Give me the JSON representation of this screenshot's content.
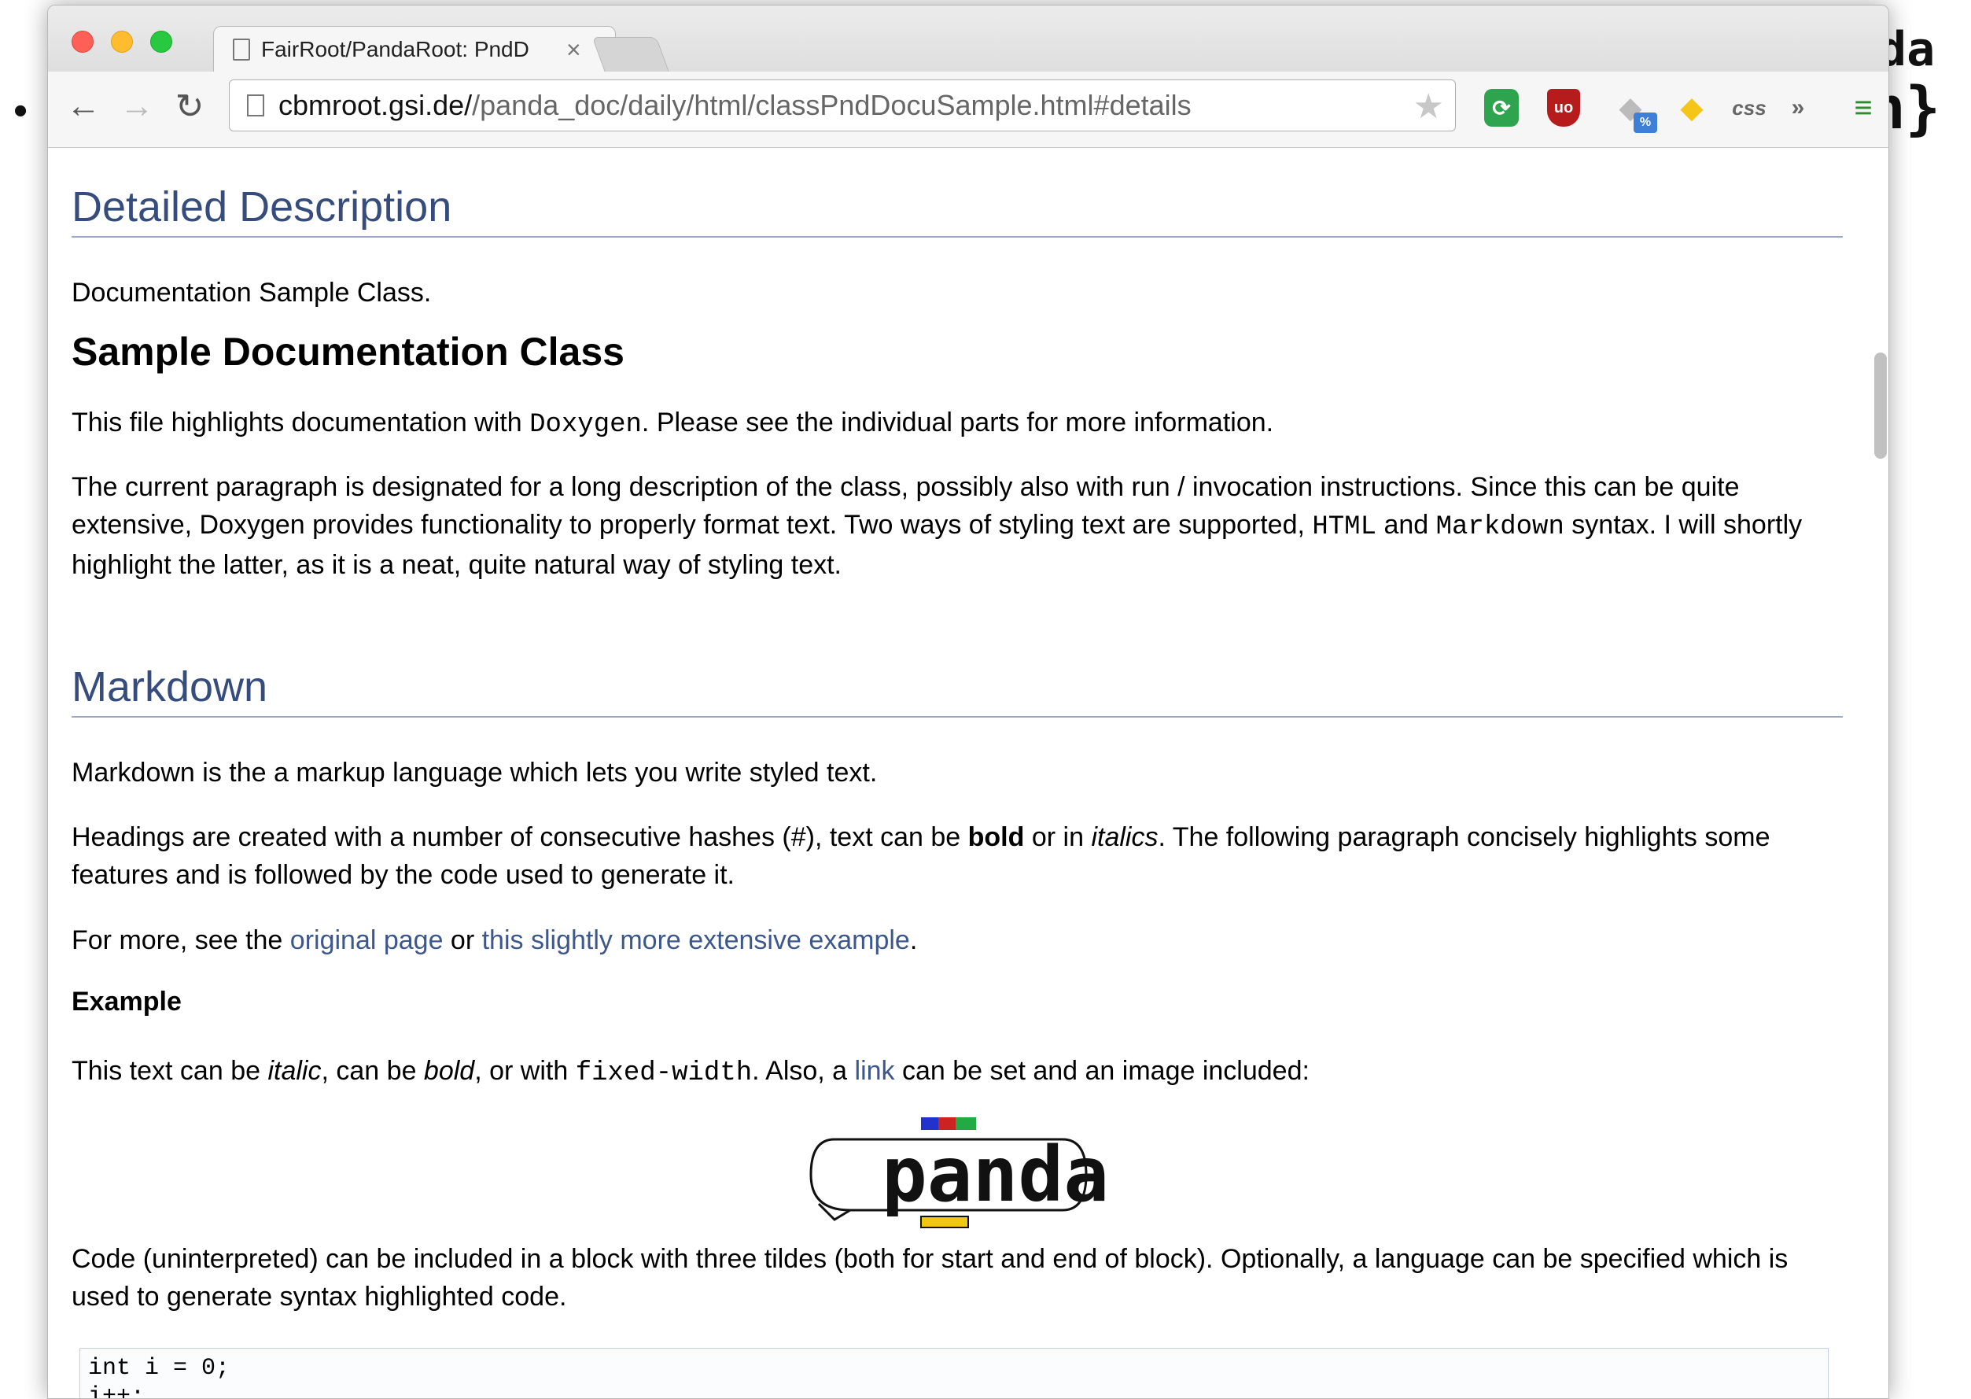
{
  "background": {
    "fragment_brace": "n}",
    "fragment_da": "da",
    "fragment_bullet": "•"
  },
  "browser": {
    "tab_title": "FairRoot/PandaRoot: PndD",
    "tab_close": "×",
    "url_host": "cbmroot.gsi.de/",
    "url_path": "/panda_doc/daily/html/classPndDocuSample.html#details",
    "icons": {
      "back": "←",
      "forward": "→",
      "reload": "↻",
      "star": "★",
      "ext_sync": "⟳",
      "ext_ublock": "uo",
      "ext_tag": "◆",
      "ext_pct": "%",
      "ext_python": "◆",
      "ext_css": "css",
      "ext_more": "»",
      "menu": "≡"
    },
    "colors": {
      "traffic_close": "#fe5f57",
      "traffic_min": "#febc2e",
      "traffic_max": "#28c840"
    }
  },
  "doc": {
    "detailed_heading": "Detailed Description",
    "brief": "Documentation Sample Class.",
    "sample_heading": "Sample Documentation Class",
    "para1": {
      "pre": "This file highlights documentation with ",
      "code": "Doxygen",
      "post": ". Please see the individual parts for more information."
    },
    "para2": {
      "pre": "The current paragraph is designated for a long description of the class, possibly also with run / invocation instructions. Since this can be quite extensive, Doxygen provides functionality to properly format text. Two ways of styling text are supported, ",
      "code1": "HTML",
      "mid": " and ",
      "code2": "Markdown",
      "post": " syntax. I will shortly highlight the latter, as it is a neat, quite natural way of styling text."
    },
    "markdown_heading": "Markdown",
    "md_p1": "Markdown is the a markup language which lets you write styled text.",
    "md_p2": {
      "pre": "Headings are created with a number of consecutive hashes (#), text can be ",
      "bold": "bold",
      "mid": " or in ",
      "italic": "italics",
      "post": ". The following paragraph concisely highlights some features and is followed by the code used to generate it."
    },
    "md_p3": {
      "pre": "For more, see the ",
      "link1": "original page",
      "mid": " or ",
      "link2": "this slightly more extensive example",
      "post": "."
    },
    "example_heading": "Example",
    "md_p4": {
      "pre": "This text can be ",
      "italic": "italic",
      "mid1": ", can be ",
      "bold": "bold",
      "mid2": ", or with ",
      "code": "fixed-width",
      "mid3": ". Also, a ",
      "link": "link",
      "post": " can be set and an image included:"
    },
    "logo_text": "panda",
    "md_p5": "Code (uninterpreted) can be included in a block with three tildes (both for start and end of block). Optionally, a language can be specified which is used to generate syntax highlighted code.",
    "code_line1": "int i = 0;",
    "code_line2": "i++;"
  }
}
